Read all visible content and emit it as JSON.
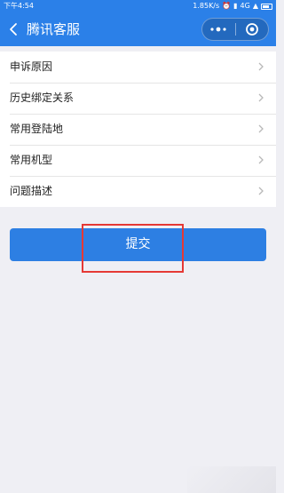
{
  "status_bar": {
    "time": "下午4:54",
    "speed": "1.85K/s",
    "network": "4G"
  },
  "nav": {
    "title": "腾讯客服",
    "back_icon": "chevron-left-icon",
    "more_icon": "more-dots-icon",
    "close_icon": "target-close-icon"
  },
  "menu": {
    "items": [
      {
        "label": "申诉原因"
      },
      {
        "label": "历史绑定关系"
      },
      {
        "label": "常用登陆地"
      },
      {
        "label": "常用机型"
      },
      {
        "label": "问题描述"
      }
    ]
  },
  "submit": {
    "label": "提交"
  },
  "colors": {
    "brand": "#2b80e8",
    "button": "#2d7fe3",
    "highlight": "#e53935",
    "background": "#efeff4"
  }
}
